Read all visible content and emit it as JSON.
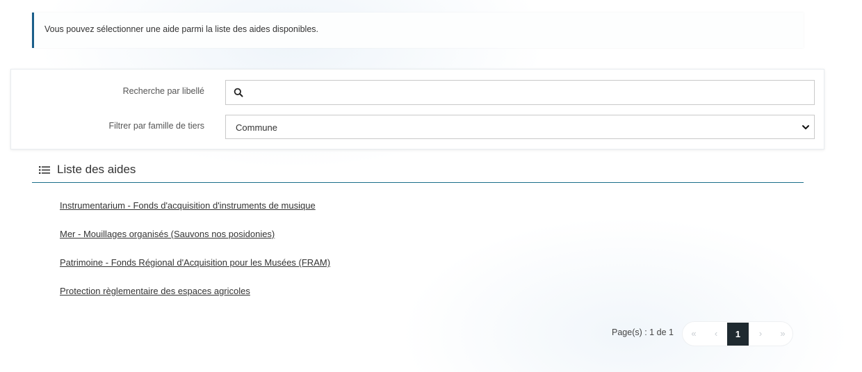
{
  "info": {
    "message": "Vous pouvez sélectionner une aide parmi la liste des aides disponibles."
  },
  "filters": {
    "search_label": "Recherche par libellé",
    "search_value": "",
    "family_label": "Filtrer par famille de tiers",
    "family_selected": "Commune"
  },
  "list": {
    "title": "Liste des aides",
    "items": [
      "Instrumentarium - Fonds d'acquisition d'instruments de musique",
      "Mer - Mouillages organisés (Sauvons nos posidonies)",
      "Patrimoine - Fonds Régional d'Acquisition pour les Musées (FRAM)",
      "Protection règlementaire des espaces agricoles"
    ]
  },
  "pagination": {
    "summary": "Page(s) : 1 de 1",
    "first": "«",
    "prev": "‹",
    "current": "1",
    "next": "›",
    "last": "»"
  },
  "colors": {
    "accent": "#1a5e8a",
    "active_page": "#1f2a30"
  },
  "icons": {
    "search": "search-icon",
    "list": "list-icon",
    "dropdown": "chevron-down-icon"
  }
}
